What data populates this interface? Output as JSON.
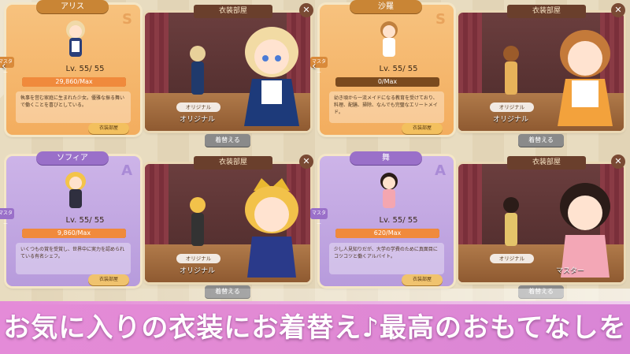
{
  "panels": [
    {
      "name": "アリス",
      "rank": "S",
      "level": "Lv. 55/ 55",
      "affinity": "29,860/Max",
      "affinity_fraction": 1.0,
      "master": "マスター",
      "description": "執事を営む家庭に生まれた少女。優雅な振る舞いで働くことを喜びとしている。",
      "wardrobe_button": "衣装部屋",
      "room_title": "衣装部屋",
      "outfit": "オリジナル",
      "outfit2": "オリジナル",
      "change": "着替える",
      "theme": "orange"
    },
    {
      "name": "沙羅",
      "rank": "S",
      "level": "Lv. 55/ 55",
      "affinity": "0/Max",
      "affinity_fraction": 0.0,
      "master": "マスター",
      "description": "幼き頃から一流メイドになる教育を受けており、料理、配膳、掃除、なんでも完璧なエリートメイド。",
      "wardrobe_button": "衣装部屋",
      "room_title": "衣装部屋",
      "outfit": "オリジナル",
      "outfit2": "オリジナル",
      "change": "着替える",
      "theme": "orange"
    },
    {
      "name": "ソフィア",
      "rank": "A",
      "level": "Lv. 55/ 55",
      "affinity": "9,860/Max",
      "affinity_fraction": 1.0,
      "master": "マスター",
      "description": "いくつもの賞を受賞し、世界中に実力を認められている有名シェフ。",
      "wardrobe_button": "衣装部屋",
      "room_title": "衣装部屋",
      "outfit": "オリジナル",
      "outfit2": "オリジナル",
      "change": "着替える",
      "theme": "purple"
    },
    {
      "name": "舞",
      "rank": "A",
      "level": "Lv. 55/ 55",
      "affinity": "620/Max",
      "affinity_fraction": 1.0,
      "master": "マスター",
      "description": "少し人見知りだが、大学の学費のために真面目にコツコツと働くアルバイト。",
      "wardrobe_button": "衣装部屋",
      "room_title": "衣装部屋",
      "outfit": "オリジナル",
      "outfit2": "マスター",
      "change": "着替える",
      "theme": "purple"
    }
  ],
  "banner": "お気に入りの衣装にお着替え♪最高のおもてなしを",
  "colors": {
    "banner": "#e48bd8",
    "orange_card": "#f3ad5e",
    "purple_card": "#b79bdc"
  }
}
